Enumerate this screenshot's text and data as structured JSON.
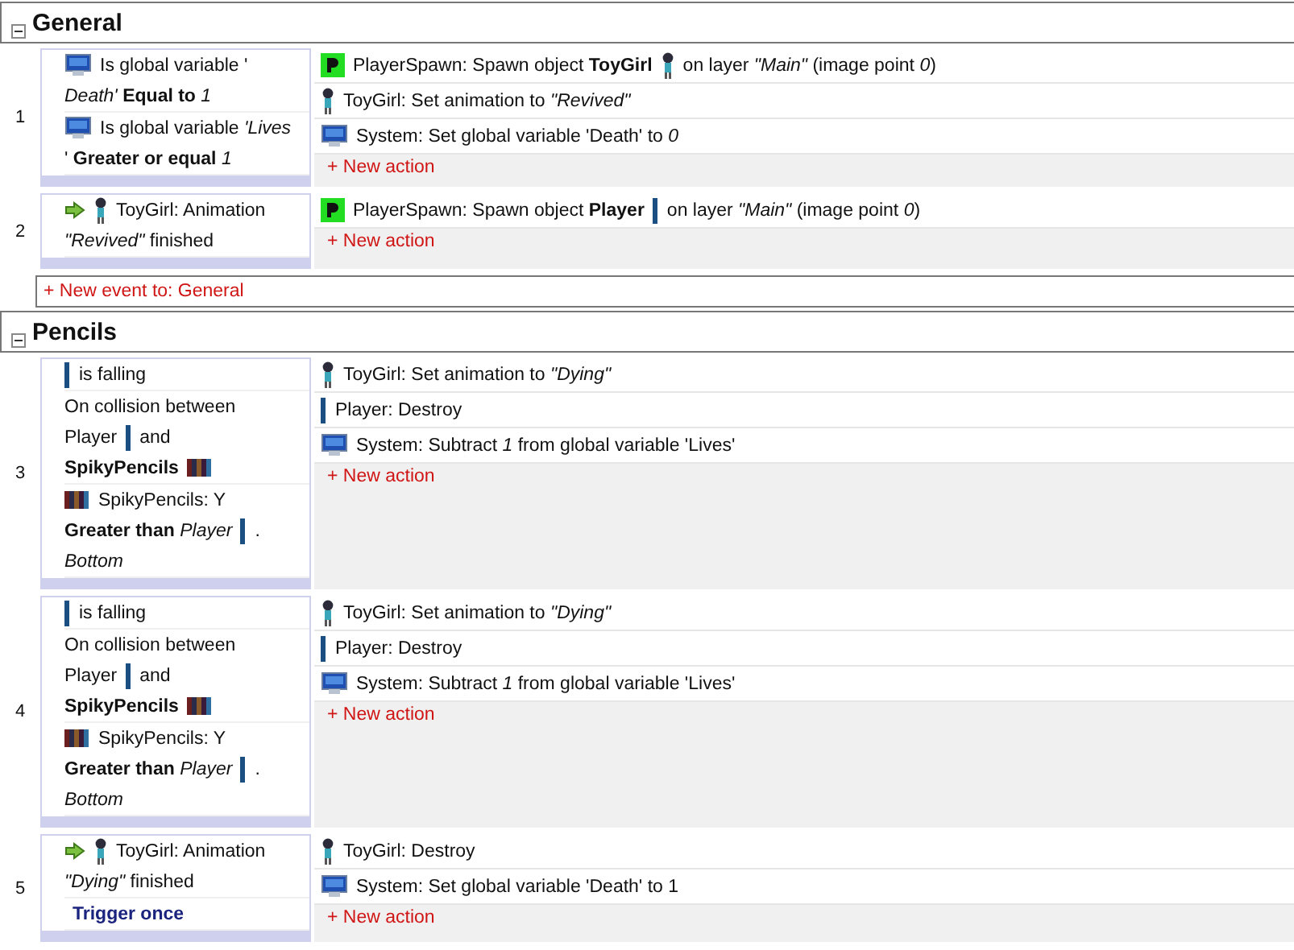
{
  "groups": [
    {
      "title": "General",
      "expanded": true,
      "events": [
        {
          "number": "1",
          "conditions": [
            {
              "kind": "normal",
              "lines": [
                [
                  {
                    "kind": "system"
                  },
                  {
                    "kind": "text",
                    "text": "Is global variable '"
                  }
                ],
                [
                  {
                    "kind": "text",
                    "text": "*Death'* **Equal to** *1*"
                  }
                ]
              ]
            },
            {
              "kind": "normal",
              "lines": [
                [
                  {
                    "kind": "system"
                  },
                  {
                    "kind": "text",
                    "text": "Is global variable *'Lives*"
                  }
                ],
                [
                  {
                    "kind": "text",
                    "text": "' **Greater or equal** *1*"
                  }
                ]
              ]
            }
          ],
          "actions": [
            [
              {
                "kind": "spawn"
              },
              {
                "kind": "text",
                "text": "PlayerSpawn: Spawn object **ToyGirl**"
              },
              {
                "kind": "girl"
              },
              {
                "kind": "text",
                "text": "on layer *\"Main\"* (image point *0*)"
              }
            ],
            [
              {
                "kind": "girl"
              },
              {
                "kind": "text",
                "text": "ToyGirl: Set animation to *\"Revived\"*"
              }
            ],
            [
              {
                "kind": "system"
              },
              {
                "kind": "text",
                "text": "System: Set global variable 'Death' to *0*"
              }
            ]
          ],
          "new_action": "+ New action"
        },
        {
          "number": "2",
          "conditions": [
            {
              "kind": "normal",
              "lines": [
                [
                  {
                    "kind": "trigger"
                  },
                  {
                    "kind": "girl"
                  },
                  {
                    "kind": "text",
                    "text": "ToyGirl: Animation"
                  }
                ],
                [
                  {
                    "kind": "text",
                    "text": "*\"Revived\"* finished"
                  }
                ]
              ]
            }
          ],
          "actions": [
            [
              {
                "kind": "spawn"
              },
              {
                "kind": "text",
                "text": "PlayerSpawn: Spawn object **Player**"
              },
              {
                "kind": "bar"
              },
              {
                "kind": "text",
                "text": "on layer *\"Main\"* (image point *0*)"
              }
            ]
          ],
          "new_action": "+ New action"
        }
      ],
      "new_event": "+ New event to: General"
    },
    {
      "title": "Pencils",
      "expanded": true,
      "events": [
        {
          "number": "3",
          "conditions": [
            {
              "kind": "normal",
              "lines": [
                [
                  {
                    "kind": "bar"
                  },
                  {
                    "kind": "text",
                    "text": "is falling"
                  }
                ]
              ]
            },
            {
              "kind": "normal",
              "lines": [
                [
                  {
                    "kind": "text",
                    "text": "On collision between"
                  }
                ],
                [
                  {
                    "kind": "text",
                    "text": "Player"
                  },
                  {
                    "kind": "bar"
                  },
                  {
                    "kind": "text",
                    "text": "and"
                  }
                ],
                [
                  {
                    "kind": "text",
                    "text": "**SpikyPencils**"
                  },
                  {
                    "kind": "pencils"
                  }
                ]
              ]
            },
            {
              "kind": "normal",
              "lines": [
                [
                  {
                    "kind": "pencils"
                  },
                  {
                    "kind": "text",
                    "text": "SpikyPencils:  Y"
                  }
                ],
                [
                  {
                    "kind": "text",
                    "text": "**Greater than** *Player*"
                  },
                  {
                    "kind": "bar"
                  },
                  {
                    "kind": "text",
                    "text": "."
                  }
                ],
                [
                  {
                    "kind": "text",
                    "text": "*Bottom*"
                  }
                ]
              ]
            }
          ],
          "actions": [
            [
              {
                "kind": "girl"
              },
              {
                "kind": "text",
                "text": "ToyGirl: Set animation to *\"Dying\"*"
              }
            ],
            [
              {
                "kind": "bar"
              },
              {
                "kind": "text",
                "text": "Player: Destroy"
              }
            ],
            [
              {
                "kind": "system"
              },
              {
                "kind": "text",
                "text": "System: Subtract *1* from global variable 'Lives'"
              }
            ]
          ],
          "new_action": "+ New action"
        },
        {
          "number": "4",
          "conditions": [
            {
              "kind": "normal",
              "lines": [
                [
                  {
                    "kind": "bar"
                  },
                  {
                    "kind": "text",
                    "text": "is falling"
                  }
                ]
              ]
            },
            {
              "kind": "normal",
              "lines": [
                [
                  {
                    "kind": "text",
                    "text": "On collision between"
                  }
                ],
                [
                  {
                    "kind": "text",
                    "text": "Player"
                  },
                  {
                    "kind": "bar"
                  },
                  {
                    "kind": "text",
                    "text": "and"
                  }
                ],
                [
                  {
                    "kind": "text",
                    "text": "**SpikyPencils**"
                  },
                  {
                    "kind": "pencils"
                  }
                ]
              ]
            },
            {
              "kind": "normal",
              "lines": [
                [
                  {
                    "kind": "pencils"
                  },
                  {
                    "kind": "text",
                    "text": "SpikyPencils:  Y"
                  }
                ],
                [
                  {
                    "kind": "text",
                    "text": "**Greater than** *Player*"
                  },
                  {
                    "kind": "bar"
                  },
                  {
                    "kind": "text",
                    "text": "."
                  }
                ],
                [
                  {
                    "kind": "text",
                    "text": "*Bottom*"
                  }
                ]
              ]
            }
          ],
          "actions": [
            [
              {
                "kind": "girl"
              },
              {
                "kind": "text",
                "text": "ToyGirl: Set animation to *\"Dying\"*"
              }
            ],
            [
              {
                "kind": "bar"
              },
              {
                "kind": "text",
                "text": "Player: Destroy"
              }
            ],
            [
              {
                "kind": "system"
              },
              {
                "kind": "text",
                "text": "System: Subtract *1* from global variable 'Lives'"
              }
            ]
          ],
          "new_action": "+ New action"
        },
        {
          "number": "5",
          "conditions": [
            {
              "kind": "normal",
              "lines": [
                [
                  {
                    "kind": "trigger"
                  },
                  {
                    "kind": "girl"
                  },
                  {
                    "kind": "text",
                    "text": "ToyGirl: Animation"
                  }
                ],
                [
                  {
                    "kind": "text",
                    "text": "*\"Dying\"* finished"
                  }
                ]
              ]
            },
            {
              "kind": "special",
              "lines": [
                [
                  {
                    "kind": "text",
                    "text": "Trigger once"
                  }
                ]
              ]
            }
          ],
          "actions": [
            [
              {
                "kind": "girl"
              },
              {
                "kind": "text",
                "text": "ToyGirl: Destroy"
              }
            ],
            [
              {
                "kind": "system"
              },
              {
                "kind": "text",
                "text": "System: Set global variable 'Death' to 1"
              }
            ]
          ],
          "new_action": "+ New action"
        }
      ]
    }
  ]
}
